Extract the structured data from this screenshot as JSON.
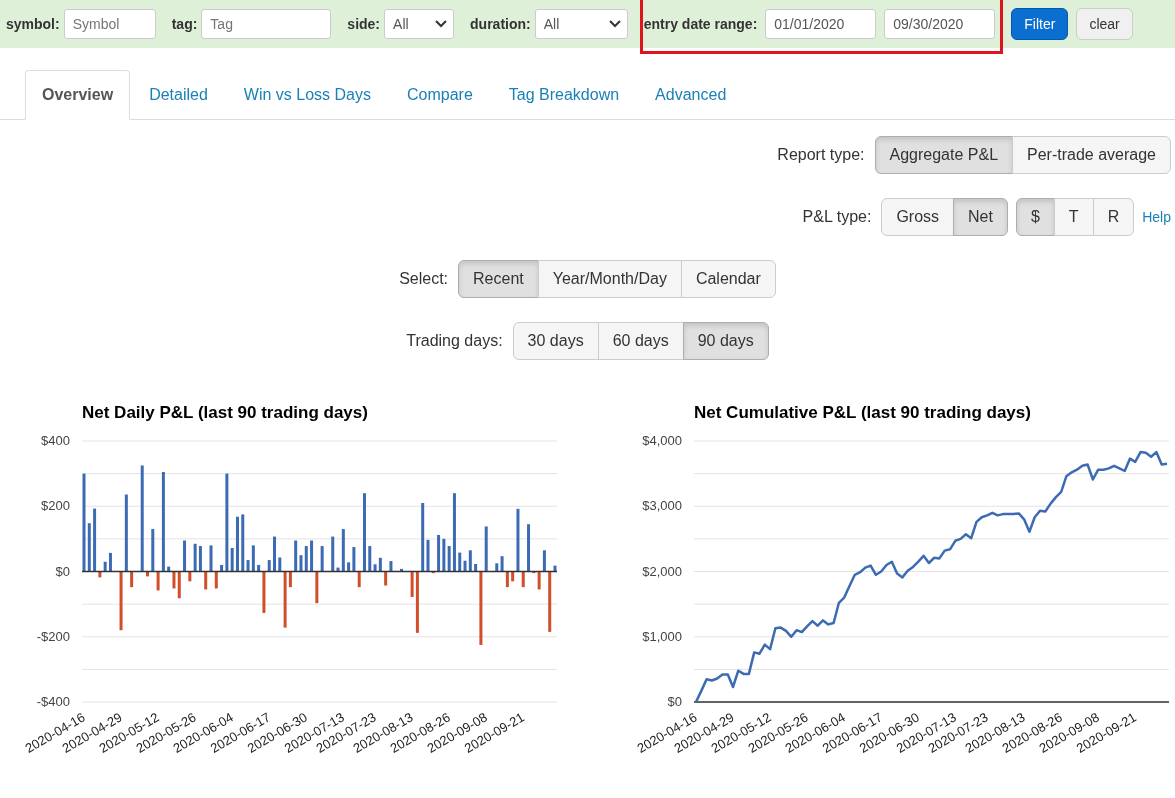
{
  "filters": {
    "fields": [
      {
        "kind": "text",
        "label": "symbol:",
        "placeholder": "Symbol"
      },
      {
        "kind": "text",
        "label": "tag:",
        "placeholder": "Tag"
      },
      {
        "kind": "select",
        "label": "side:",
        "value": "All"
      },
      {
        "kind": "select",
        "label": "duration:",
        "value": "All"
      }
    ],
    "date_range": {
      "label": "entry date range:",
      "from": "01/01/2020",
      "to": "09/30/2020",
      "highlighted": true
    },
    "buttons": [
      {
        "label": "Filter",
        "kind": "primary"
      },
      {
        "label": "clear",
        "kind": "secondary"
      }
    ]
  },
  "tabs": [
    {
      "label": "Overview",
      "selected": true
    },
    {
      "label": "Detailed",
      "selected": false
    },
    {
      "label": "Win vs Loss Days",
      "selected": false
    },
    {
      "label": "Compare",
      "selected": false
    },
    {
      "label": "Tag Breakdown",
      "selected": false
    },
    {
      "label": "Advanced",
      "selected": false
    }
  ],
  "report_type": {
    "label": "Report type:",
    "options": [
      {
        "label": "Aggregate P&L",
        "selected": true
      },
      {
        "label": "Per-trade average",
        "selected": false
      }
    ]
  },
  "pl_type": {
    "label": "P&L type:",
    "options": [
      {
        "label": "Gross",
        "selected": false
      },
      {
        "label": "Net",
        "selected": true
      }
    ]
  },
  "unit_options": [
    {
      "label": "$",
      "selected": true
    },
    {
      "label": "T",
      "selected": false
    },
    {
      "label": "R",
      "selected": false
    }
  ],
  "help_link": "Help",
  "select": {
    "label": "Select:",
    "options": [
      {
        "label": "Recent",
        "selected": true
      },
      {
        "label": "Year/Month/Day",
        "selected": false
      },
      {
        "label": "Calendar",
        "selected": false
      }
    ]
  },
  "trading_days": {
    "label": "Trading days:",
    "options": [
      {
        "label": "30 days",
        "selected": false
      },
      {
        "label": "60 days",
        "selected": false
      },
      {
        "label": "90 days",
        "selected": true
      }
    ]
  },
  "charts": [
    {
      "title": "Net Daily P&L (last 90 trading days)",
      "chart_data": {
        "type": "bar",
        "stacked": true,
        "grid": true,
        "ylim": [
          -400,
          400
        ],
        "yticks": [
          {
            "value": -400,
            "label": "-$400"
          },
          {
            "value": -200,
            "label": "-$200"
          },
          {
            "value": 0,
            "label": "$0"
          },
          {
            "value": 200,
            "label": "$200"
          },
          {
            "value": 400,
            "label": "$400"
          }
        ],
        "categories": [
          "2020-04-16",
          null,
          null,
          null,
          null,
          null,
          null,
          "2020-04-29",
          null,
          null,
          null,
          null,
          null,
          null,
          "2020-05-12",
          null,
          null,
          null,
          null,
          null,
          null,
          "2020-05-26",
          null,
          null,
          null,
          null,
          null,
          null,
          "2020-06-04",
          null,
          null,
          null,
          null,
          null,
          null,
          "2020-06-17",
          null,
          null,
          null,
          null,
          null,
          null,
          "2020-06-30",
          null,
          null,
          null,
          null,
          null,
          null,
          "2020-07-13",
          null,
          null,
          null,
          null,
          null,
          "2020-07-23",
          null,
          null,
          null,
          null,
          null,
          null,
          "2020-08-13",
          null,
          null,
          null,
          null,
          null,
          null,
          "2020-08-26",
          null,
          null,
          null,
          null,
          null,
          null,
          "2020-09-08",
          null,
          null,
          null,
          null,
          null,
          null,
          "2020-09-21",
          null,
          null,
          null,
          null,
          null,
          null
        ],
        "series": [
          {
            "color": "#3c6bb4",
            "values": [
              300,
              148,
              193,
              null,
              30,
              57,
              null,
              null,
              236,
              null,
              null,
              325,
              null,
              130,
              null,
              305,
              15,
              null,
              null,
              95,
              null,
              85,
              78,
              null,
              80,
              null,
              20,
              300,
              72,
              168,
              175,
              35,
              80,
              20,
              null,
              35,
              107,
              43,
              null,
              null,
              95,
              50,
              78,
              95,
              null,
              78,
              null,
              107,
              12,
              130,
              28,
              75,
              null,
              240,
              78,
              22,
              42,
              null,
              32,
              null,
              8,
              null,
              null,
              null,
              210,
              97,
              null,
              112,
              100,
              78,
              240,
              58,
              33,
              65,
              23,
              null,
              138,
              null,
              25,
              47,
              null,
              null,
              192,
              null,
              145,
              null,
              null,
              65,
              null,
              18
            ]
          },
          {
            "color": "#d24d2a",
            "values": [
              null,
              null,
              null,
              -18,
              null,
              null,
              null,
              -180,
              null,
              -48,
              null,
              null,
              -15,
              null,
              -58,
              null,
              null,
              -52,
              -82,
              null,
              -30,
              null,
              null,
              -55,
              null,
              -52,
              null,
              null,
              null,
              null,
              null,
              null,
              null,
              null,
              -127,
              null,
              null,
              null,
              -172,
              -48,
              null,
              null,
              null,
              null,
              -97,
              null,
              null,
              null,
              null,
              null,
              null,
              null,
              -48,
              null,
              null,
              null,
              null,
              -43,
              null,
              null,
              null,
              null,
              -78,
              -188,
              null,
              null,
              -5,
              null,
              null,
              null,
              null,
              null,
              null,
              null,
              null,
              -225,
              null,
              null,
              null,
              null,
              -48,
              -30,
              null,
              -48,
              null,
              -5,
              -55,
              null,
              -185,
              null
            ]
          }
        ]
      }
    },
    {
      "title": "Net Cumulative P&L (last 90 trading days)",
      "chart_data": {
        "type": "line",
        "grid": true,
        "ylim": [
          0,
          4000
        ],
        "yticks": [
          {
            "value": 0,
            "label": "$0"
          },
          {
            "value": 1000,
            "label": "$1,000"
          },
          {
            "value": 2000,
            "label": "$2,000"
          },
          {
            "value": 3000,
            "label": "$3,000"
          },
          {
            "value": 4000,
            "label": "$4,000"
          }
        ],
        "categories": [
          "2020-04-16",
          null,
          null,
          null,
          null,
          null,
          null,
          "2020-04-29",
          null,
          null,
          null,
          null,
          null,
          null,
          "2020-05-12",
          null,
          null,
          null,
          null,
          null,
          null,
          "2020-05-26",
          null,
          null,
          null,
          null,
          null,
          null,
          "2020-06-04",
          null,
          null,
          null,
          null,
          null,
          null,
          "2020-06-17",
          null,
          null,
          null,
          null,
          null,
          null,
          "2020-06-30",
          null,
          null,
          null,
          null,
          null,
          null,
          "2020-07-13",
          null,
          null,
          null,
          null,
          null,
          "2020-07-23",
          null,
          null,
          null,
          null,
          null,
          null,
          "2020-08-13",
          null,
          null,
          null,
          null,
          null,
          null,
          "2020-08-26",
          null,
          null,
          null,
          null,
          null,
          null,
          "2020-09-08",
          null,
          null,
          null,
          null,
          null,
          null,
          "2020-09-21",
          null,
          null,
          null,
          null,
          null,
          null
        ],
        "series": [
          {
            "color": "#3c6bb4",
            "values": [
              0,
              170,
              350,
              330,
              360,
              420,
              420,
              230,
              480,
              430,
              430,
              760,
              740,
              880,
              810,
              1130,
              1140,
              1090,
              1000,
              1100,
              1070,
              1160,
              1240,
              1170,
              1250,
              1190,
              1210,
              1520,
              1600,
              1780,
              1950,
              1990,
              2060,
              2090,
              1950,
              2000,
              2100,
              2150,
              1970,
              1910,
              2010,
              2070,
              2150,
              2240,
              2130,
              2210,
              2200,
              2320,
              2340,
              2470,
              2500,
              2570,
              2510,
              2760,
              2830,
              2860,
              2900,
              2860,
              2880,
              2880,
              2880,
              2890,
              2800,
              2610,
              2830,
              2930,
              2920,
              3040,
              3140,
              3220,
              3460,
              3520,
              3560,
              3620,
              3640,
              3410,
              3560,
              3560,
              3580,
              3620,
              3580,
              3540,
              3730,
              3680,
              3830,
              3820,
              3760,
              3830,
              3640,
              3650
            ]
          }
        ]
      }
    }
  ]
}
